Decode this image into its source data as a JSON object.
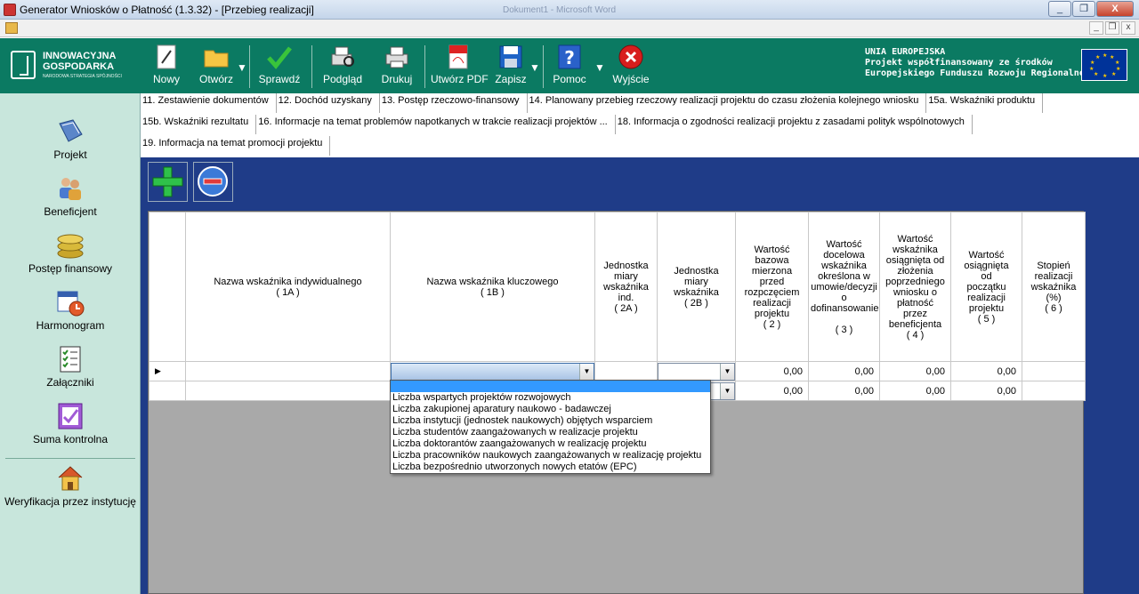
{
  "window": {
    "title": "Generator Wniosków o Płatność (1.3.32) - [Przebieg realizacji]",
    "ghost_title": "Dokument1 - Microsoft Word",
    "controls": {
      "minimize": "_",
      "restore": "❐",
      "close": "X"
    },
    "mdi_controls": {
      "minimize": "_",
      "restore": "❐",
      "close": "x"
    }
  },
  "logo": {
    "line1": "INNOWACYJNA",
    "line2": "GOSPODARKA",
    "line3": "NARODOWA STRATEGIA SPÓJNOŚCI"
  },
  "toolbar": {
    "buttons": [
      {
        "label": "Nowy",
        "icon": "new-document-icon"
      },
      {
        "label": "Otwórz",
        "icon": "open-folder-icon"
      },
      {
        "label": "Sprawdź",
        "icon": "check-icon"
      },
      {
        "label": "Podgląd",
        "icon": "print-preview-icon"
      },
      {
        "label": "Drukuj",
        "icon": "printer-icon"
      },
      {
        "label": "Utwórz PDF",
        "icon": "pdf-icon"
      },
      {
        "label": "Zapisz",
        "icon": "save-disk-icon"
      },
      {
        "label": "Pomoc",
        "icon": "help-icon"
      },
      {
        "label": "Wyjście",
        "icon": "exit-icon"
      }
    ],
    "dropdown_glyph": "▼"
  },
  "eu": {
    "line1": "UNIA EUROPEJSKA",
    "line2": "Projekt współfinansowany ze środków",
    "line3": "Europejskiego Funduszu Rozwoju Regionalnego"
  },
  "sidebar": {
    "items": [
      {
        "label": "Projekt",
        "icon": "project-book-icon"
      },
      {
        "label": "Beneficjent",
        "icon": "beneficiary-people-icon"
      },
      {
        "label": "Postęp finansowy",
        "icon": "coins-icon"
      },
      {
        "label": "Harmonogram",
        "icon": "calendar-clock-icon"
      },
      {
        "label": "Załączniki",
        "icon": "checklist-icon"
      },
      {
        "label": "Suma kontrolna",
        "icon": "checksum-icon"
      },
      {
        "label": "Weryfikacja przez instytucję",
        "icon": "house-icon"
      }
    ]
  },
  "tabs": {
    "row1": [
      "11. Zestawienie dokumentów",
      "12. Dochód uzyskany",
      "13. Postęp rzeczowo-finansowy",
      "14. Planowany przebieg rzeczowy realizacji projektu do czasu złożenia kolejnego wniosku",
      "15a. Wskaźniki produktu"
    ],
    "row2": [
      "15b. Wskaźniki rezultatu",
      "16. Informacje na temat problemów napotkanych w trakcie realizacji projektów ...",
      "18. Informacja o zgodności realizacji projektu z zasadami polityk wspólnotowych"
    ],
    "row3": [
      "19. Informacja na temat promocji projektu"
    ]
  },
  "grid_buttons": {
    "add": "add-row-icon",
    "remove": "remove-row-icon"
  },
  "table": {
    "headers": [
      {
        "lines": [
          "Nazwa wskaźnika indywidualnego",
          "( 1A )"
        ]
      },
      {
        "lines": [
          "Nazwa wskaźnika kluczowego",
          "( 1B )"
        ]
      },
      {
        "lines": [
          "Jednostka",
          "miary",
          "wskaźnika",
          "ind.",
          "( 2A )"
        ]
      },
      {
        "lines": [
          "Jednostka",
          "miary",
          "wskaźnika",
          "( 2B )"
        ]
      },
      {
        "lines": [
          "Wartość",
          "bazowa",
          "mierzona",
          "przed",
          "rozpczęciem",
          "realizacji",
          "projektu",
          "( 2 )"
        ]
      },
      {
        "lines": [
          "Wartość",
          "docelowa",
          "wskaźnika",
          "określona w",
          "umowie/decyzji",
          "o",
          "dofinansowanie",
          "",
          "( 3 )"
        ]
      },
      {
        "lines": [
          "Wartość",
          "wskaźnika",
          "osiągnięta od",
          "złożenia",
          "poprzedniego",
          "wniosku o",
          "płatność",
          "przez",
          "beneficjenta",
          "( 4 )"
        ]
      },
      {
        "lines": [
          "Wartość",
          "osiągnięta",
          "od",
          "początku",
          "realizacji",
          "projektu",
          "( 5 )"
        ]
      },
      {
        "lines": [
          "Stopień",
          "realizacji",
          "wskaźnika",
          "(%)",
          "( 6 )"
        ]
      }
    ],
    "rows": [
      {
        "indicator": "▶",
        "v2": "0,00",
        "v3": "0,00",
        "v4": "0,00",
        "v5": "0,00"
      },
      {
        "indicator": "",
        "v2": "0,00",
        "v3": "0,00",
        "v4": "0,00",
        "v5": "0,00"
      }
    ]
  },
  "dropdown_options": [
    "Liczba wspartych projektów rozwojowych",
    "Liczba zakupionej aparatury naukowo - badawczej",
    "Liczba instytucji (jednostek naukowych) objętych wsparciem",
    "Liczba studentów zaangażowanych w realizacje projektu",
    "Liczba doktorantów zaangażowanych w realizację projektu",
    "Liczba pracowników naukowych zaangażowanych w realizację projektu",
    "Liczba bezpośrednio utworzonych nowych etatów (EPC)"
  ],
  "colors": {
    "toolbar": "#0b7a62",
    "sidebar": "#c8e6dc",
    "content_bg": "#1f3c88",
    "selection": "#3399ff"
  }
}
